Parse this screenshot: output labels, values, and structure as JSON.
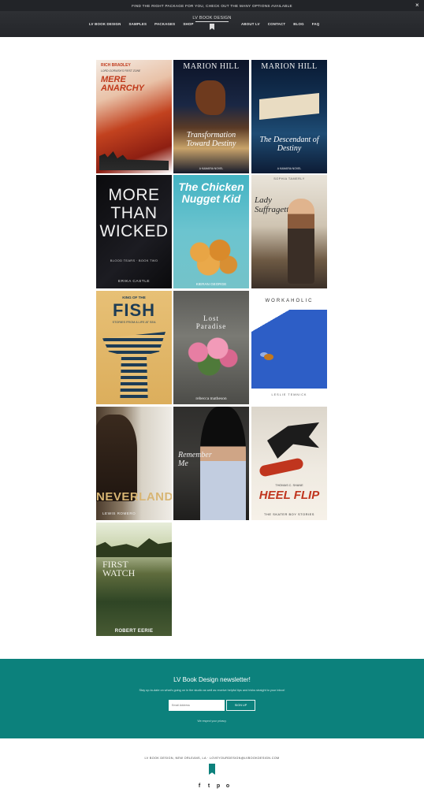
{
  "announcement": {
    "text": "FIND THE RIGHT PACKAGE FOR YOU, CHECK OUT THE MANY OPTIONS AVAILABLE",
    "close": "×"
  },
  "nav": {
    "left": [
      "LV BOOK DESIGN",
      "SAMPLES",
      "PACKAGES",
      "SHOP"
    ],
    "right": [
      "ABOUT LV",
      "CONTACT",
      "BLOG",
      "FAQ"
    ],
    "logo": "LV BOOK DESIGN"
  },
  "covers": [
    {
      "title": "MERE ANARCHY",
      "top": "RICH BRADLEY",
      "sub": "LORD GORNISH'S FIRST ZONE",
      "author": ""
    },
    {
      "title": "Transformation Toward Destiny",
      "top": "MARION HILL",
      "sub": "A KAMARIA NOVEL",
      "author": ""
    },
    {
      "title": "The Descendant of Destiny",
      "top": "MARION HILL",
      "sub": "A KAMARIA NOVEL",
      "author": ""
    },
    {
      "title": "MORE THAN WICKED",
      "top": "",
      "sub": "BLOOD TEARS · BOOK TWO",
      "author": "ERIKA CASTLE"
    },
    {
      "title": "The Chicken Nugget Kid",
      "top": "",
      "sub": "",
      "author": "KIERAN GEORGE"
    },
    {
      "title": "Lady Suffragette",
      "top": "SOPHIA TAMERLY",
      "sub": "",
      "author": ""
    },
    {
      "title": "FISH",
      "top": "KING OF THE",
      "sub": "STORIES FROM A LIFE AT SEA",
      "author": ""
    },
    {
      "title": "Lost Paradise",
      "top": "",
      "sub": "",
      "author": "rebecca matheson"
    },
    {
      "title": "WORKAHOLIC",
      "top": "",
      "sub": "",
      "author": "LESLIE TEMNICK"
    },
    {
      "title": "NEVERLAND.",
      "top": "",
      "sub": "",
      "author": "LEWIS ROMERO"
    },
    {
      "title": "Remember Me",
      "top": "",
      "sub": "",
      "author": ""
    },
    {
      "title": "HEEL FLIP",
      "top": "",
      "sub": "THE SKATER BOY STORIES",
      "author": "THOMAS C. SHANE"
    },
    {
      "title": "FIRST WATCH",
      "top": "",
      "sub": "",
      "author": "ROBERT EERIE"
    }
  ],
  "newsletter": {
    "title": "LV Book Design newsletter!",
    "text": "Stay up-to-date on what's going on in the studio as well as receive helpful tips and tricks straight to your inbox!",
    "placeholder": "Email Address",
    "button": "SIGN UP",
    "privacy": "We respect your privacy."
  },
  "footer": {
    "text": "LV BOOK DESIGN, NEW ORLEANS, LA · LOVEYOURDESIGN@LVBOOKDESIGN.COM",
    "social": [
      "f",
      "t",
      "p",
      "o"
    ]
  },
  "colors": {
    "teal": "#0c817c",
    "header": "#2a2c30"
  }
}
